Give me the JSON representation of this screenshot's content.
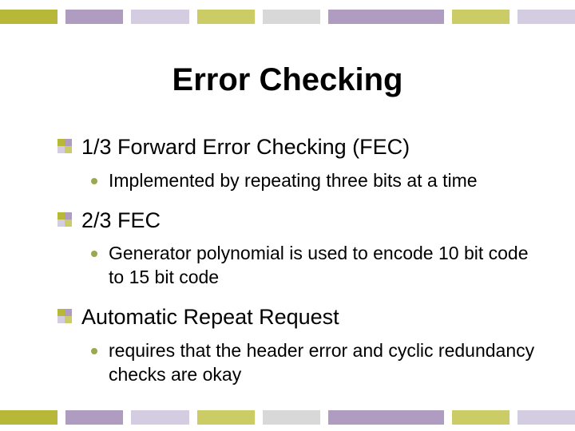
{
  "title": "Error Checking",
  "items": [
    {
      "label": "1/3 Forward Error Checking (FEC)",
      "sub": "Implemented by repeating three bits at a time"
    },
    {
      "label": "2/3 FEC",
      "sub": "Generator polynomial is used to encode 10 bit code to 15 bit code"
    },
    {
      "label": "Automatic Repeat Request",
      "sub": "requires that the header error and cyclic redundancy checks are okay"
    }
  ]
}
